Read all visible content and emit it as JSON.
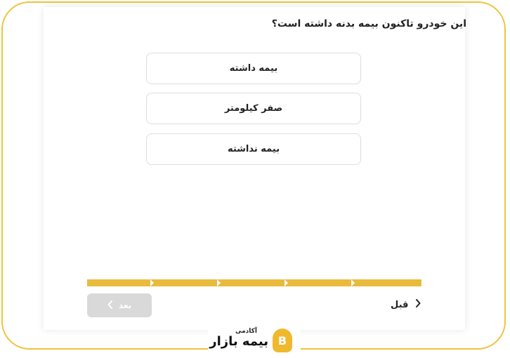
{
  "question": "این خودرو تاکنون بیمه بدنه داشته است؟",
  "options": [
    {
      "label": "بیمه داشته"
    },
    {
      "label": "صفر کیلومتر"
    },
    {
      "label": "بیمه نداشته"
    }
  ],
  "progress": {
    "steps": 5,
    "completed": 5,
    "color": "#e9bb3d"
  },
  "nav": {
    "next_label": "بعد",
    "prev_label": "قبل"
  },
  "logo": {
    "small_text": "آکادمی",
    "big_text": "بیمه بازار",
    "mark": "B",
    "accent": "#f0b92d"
  },
  "colors": {
    "frame_border": "#efc23e",
    "disabled_button": "#d9d9d9"
  }
}
